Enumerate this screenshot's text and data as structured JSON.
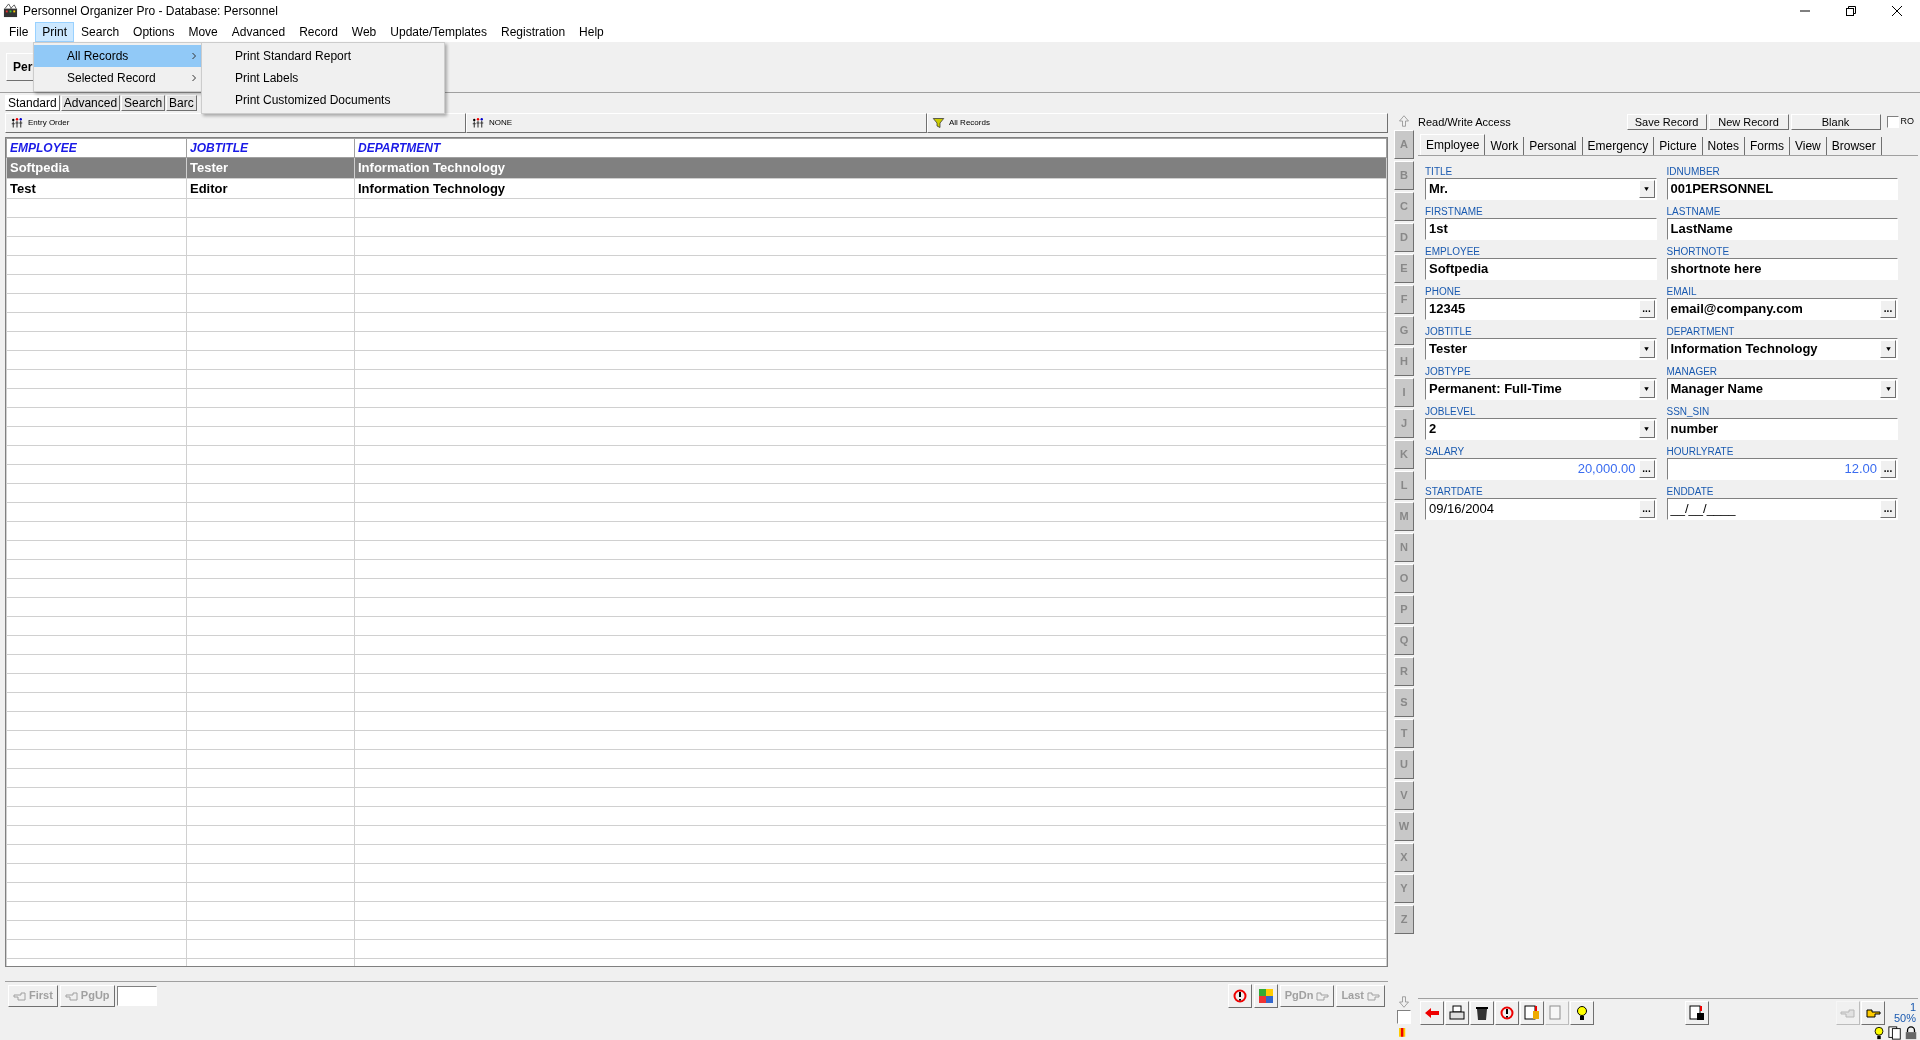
{
  "window": {
    "title": "Personnel Organizer Pro - Database: Personnel"
  },
  "menu": [
    {
      "label": "File",
      "selected": false
    },
    {
      "label": "Print",
      "selected": true
    },
    {
      "label": "Search",
      "selected": false
    },
    {
      "label": "Options",
      "selected": false
    },
    {
      "label": "Move",
      "selected": false
    },
    {
      "label": "Advanced",
      "selected": false
    },
    {
      "label": "Record",
      "selected": false
    },
    {
      "label": "Web",
      "selected": false
    },
    {
      "label": "Update/Templates",
      "selected": false
    },
    {
      "label": "Registration",
      "selected": false
    },
    {
      "label": "Help",
      "selected": false
    }
  ],
  "print_menu": {
    "items": [
      {
        "label": "All Records",
        "selected": true,
        "submenu": true
      },
      {
        "label": "Selected Record",
        "selected": false,
        "submenu": true
      }
    ],
    "submenu": [
      "Print Standard Report",
      "Print Labels",
      "Print Customized Documents"
    ]
  },
  "toolbar": {
    "button": "Per"
  },
  "view_tabs": [
    {
      "label": "Standard",
      "selected": true
    },
    {
      "label": "Advanced",
      "selected": false
    },
    {
      "label": "Search",
      "selected": false
    },
    {
      "label": "Barc",
      "selected": false
    }
  ],
  "filter_bar": [
    "Entry Order",
    "NONE",
    "All Records"
  ],
  "table": {
    "columns": [
      "EMPLOYEE",
      "JOBTITLE",
      "DEPARTMENT"
    ],
    "rows": [
      {
        "cells": [
          "Softpedia",
          "Tester",
          "Information Technology"
        ],
        "selected": true
      },
      {
        "cells": [
          "Test",
          "Editor",
          "Information Technology"
        ],
        "selected": false
      }
    ]
  },
  "letter_checkbox": {
    "checked": false
  },
  "letters": [
    "A",
    "B",
    "C",
    "D",
    "E",
    "F",
    "G",
    "H",
    "I",
    "J",
    "K",
    "L",
    "M",
    "N",
    "O",
    "P",
    "Q",
    "R",
    "S",
    "T",
    "U",
    "V",
    "W",
    "X",
    "Y",
    "Z"
  ],
  "nav": {
    "left": [
      {
        "label": "First",
        "disabled": true
      },
      {
        "label": "PgUp",
        "disabled": true
      }
    ],
    "right": [
      {
        "label": "PgDn",
        "disabled": true
      },
      {
        "label": "Last",
        "disabled": true
      }
    ]
  },
  "record_panel": {
    "access": "Read/Write Access",
    "buttons": [
      "Save Record",
      "New Record",
      "Blank"
    ],
    "ro": {
      "label": "RO",
      "checked": false
    },
    "tabs": [
      {
        "label": "Employee",
        "selected": true
      },
      {
        "label": "Work",
        "selected": false
      },
      {
        "label": "Personal",
        "selected": false
      },
      {
        "label": "Emergency",
        "selected": false
      },
      {
        "label": "Picture",
        "selected": false
      },
      {
        "label": "Notes",
        "selected": false
      },
      {
        "label": "Forms",
        "selected": false
      },
      {
        "label": "View",
        "selected": false
      },
      {
        "label": "Browser",
        "selected": false
      }
    ],
    "fields": [
      {
        "label": "TITLE",
        "value": "Mr.",
        "kind": "dropdown"
      },
      {
        "label": "IDNUMBER",
        "value": "001PERSONNEL",
        "kind": "text"
      },
      {
        "label": "FIRSTNAME",
        "value": "1st",
        "kind": "text"
      },
      {
        "label": "LASTNAME",
        "value": "LastName",
        "kind": "text"
      },
      {
        "label": "EMPLOYEE",
        "value": "Softpedia",
        "kind": "text"
      },
      {
        "label": "SHORTNOTE",
        "value": "shortnote here",
        "kind": "text"
      },
      {
        "label": "PHONE",
        "value": "12345",
        "kind": "picker",
        "action": "..."
      },
      {
        "label": "EMAIL",
        "value": "email@company.com",
        "kind": "picker",
        "action": "..."
      },
      {
        "label": "JOBTITLE",
        "value": "Tester",
        "kind": "dropdown"
      },
      {
        "label": "DEPARTMENT",
        "value": "Information Technology",
        "kind": "dropdown"
      },
      {
        "label": "JOBTYPE",
        "value": "Permanent: Full-Time",
        "kind": "dropdown"
      },
      {
        "label": "MANAGER",
        "value": "Manager Name",
        "kind": "dropdown"
      },
      {
        "label": "JOBLEVEL",
        "value": "2",
        "kind": "dropdown"
      },
      {
        "label": "SSN_SIN",
        "value": "number",
        "kind": "text"
      },
      {
        "label": "SALARY",
        "value": "20,000.00",
        "kind": "amount",
        "action": "..."
      },
      {
        "label": "HOURLYRATE",
        "value": "12.00",
        "kind": "amount",
        "action": "..."
      },
      {
        "label": "STARTDATE",
        "value": "09/16/2004",
        "kind": "date",
        "action": "..."
      },
      {
        "label": "ENDDATE",
        "value": "__/__/____",
        "kind": "date",
        "action": "..."
      }
    ]
  },
  "status": {
    "record": "1",
    "zoom": "50%"
  }
}
